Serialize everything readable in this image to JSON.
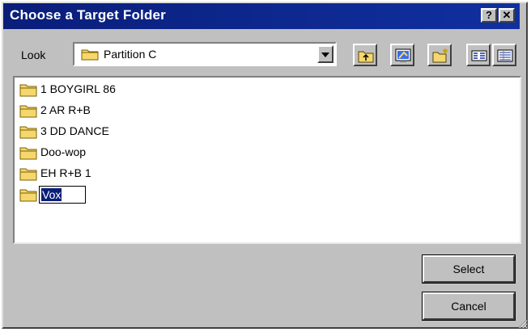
{
  "window": {
    "title": "Choose a Target Folder",
    "help_label": "?",
    "close_label": "✕"
  },
  "look": {
    "label": "Look",
    "selected": "Partition C"
  },
  "folders": [
    {
      "name": "1 BOYGIRL 86"
    },
    {
      "name": "2 AR R+B"
    },
    {
      "name": "3 DD DANCE"
    },
    {
      "name": "Doo-wop"
    },
    {
      "name": "EH R+B 1"
    }
  ],
  "rename_field": {
    "value": "Vox"
  },
  "buttons": {
    "select": "Select",
    "cancel": "Cancel"
  },
  "colors": {
    "title_bar": "#0a1e7a",
    "folder": "#f5d76e",
    "face": "#c0c0c0"
  }
}
